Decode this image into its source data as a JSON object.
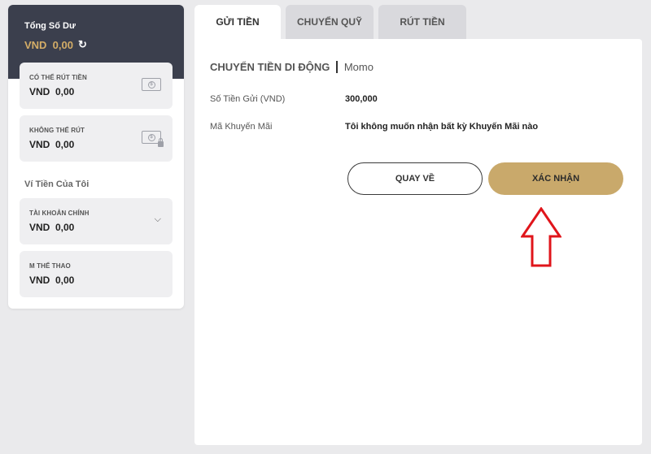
{
  "sidebar": {
    "total_label": "Tổng Số Dư",
    "total_value": "VND  0,00",
    "withdrawable": {
      "label": "CÓ THỂ RÚT TIỀN",
      "value": "VND  0,00"
    },
    "non_withdrawable": {
      "label": "KHÔNG THỂ RÚT",
      "value": "VND  0,00"
    },
    "wallet_title": "Ví Tiền Của Tôi",
    "main_account": {
      "label": "TÀI KHOẢN CHÍNH",
      "value": "VND  0,00"
    },
    "sports": {
      "label": "M THỂ THAO",
      "value": "VND  0,00"
    }
  },
  "tabs": [
    {
      "label": "GỬI TIỀN",
      "active": true
    },
    {
      "label": "CHUYỂN QUỸ",
      "active": false
    },
    {
      "label": "RÚT TIỀN",
      "active": false
    }
  ],
  "main": {
    "method_title": "CHUYỂN TIỀN DI ĐỘNG",
    "method_provider": "Momo",
    "deposit_label": "Số Tiền Gửi (VND)",
    "deposit_value": "300,000",
    "promo_label": "Mã Khuyến Mãi",
    "promo_value": "Tôi không muốn nhận bất kỳ Khuyến Mãi nào",
    "back_label": "QUAY VỀ",
    "confirm_label": "XÁC NHẬN"
  },
  "colors": {
    "accent_gold": "#c9a96b",
    "header_dark": "#3b3f4d",
    "annotation_red": "#e0151b"
  },
  "icons": [
    "refresh-icon",
    "cash-icon",
    "cash-lock-icon",
    "chevron-down-icon",
    "annotation-arrow-icon"
  ]
}
